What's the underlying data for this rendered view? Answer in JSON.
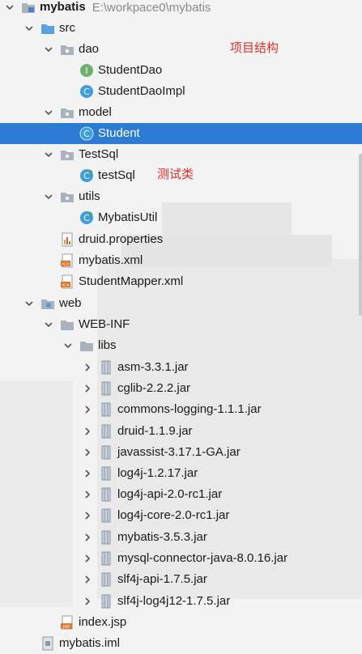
{
  "project": {
    "name": "mybatis",
    "path": "E:\\workpace0\\mybatis"
  },
  "annotations": {
    "structure": "项目结构",
    "test": "测试类"
  },
  "nodes": {
    "src": "src",
    "dao": "dao",
    "student_dao": "StudentDao",
    "student_dao_impl": "StudentDaoImpl",
    "model": "model",
    "student": "Student",
    "testsql": "TestSql",
    "test_sql": "testSql",
    "utils": "utils",
    "mybatis_util": "MybatisUtil",
    "druid_properties": "druid.properties",
    "mybatis_xml": "mybatis.xml",
    "student_mapper_xml": "StudentMapper.xml",
    "web": "web",
    "web_inf": "WEB-INF",
    "libs": "libs",
    "index_jsp": "index.jsp",
    "mybatis_iml": "mybatis.iml"
  },
  "jars": [
    "asm-3.3.1.jar",
    "cglib-2.2.2.jar",
    "commons-logging-1.1.1.jar",
    "druid-1.1.9.jar",
    "javassist-3.17.1-GA.jar",
    "log4j-1.2.17.jar",
    "log4j-api-2.0-rc1.jar",
    "log4j-core-2.0-rc1.jar",
    "mybatis-3.5.3.jar",
    "mysql-connector-java-8.0.16.jar",
    "slf4j-api-1.7.5.jar",
    "slf4j-log4j12-1.7.5.jar"
  ],
  "colors": {
    "selection": "#2d7cd3",
    "annotation": "#e0302c",
    "folder": "#a9b3bf",
    "class": "#3d9de0",
    "interface": "#6eb06d"
  }
}
